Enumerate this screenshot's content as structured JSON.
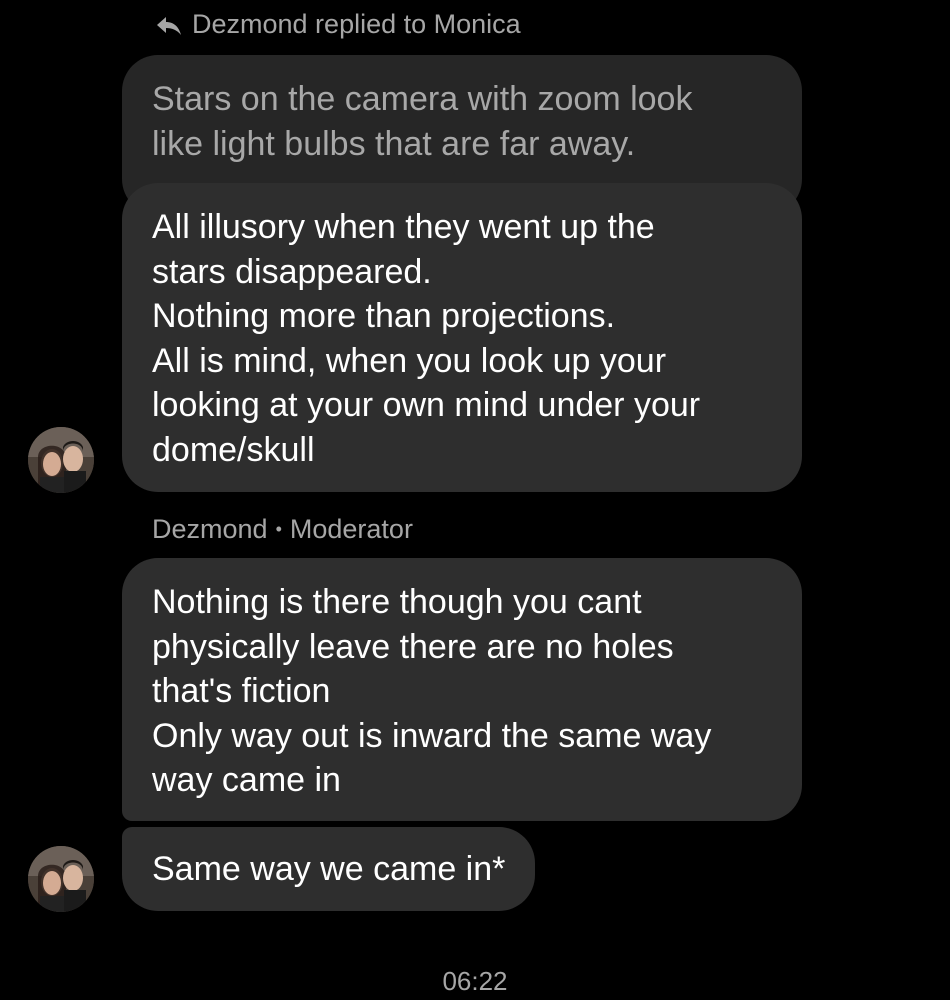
{
  "reply_header": {
    "text": "Dezmond replied to Monica",
    "icon": "reply-arrow-icon"
  },
  "quoted_message": {
    "text": "Stars on the camera with zoom look\nlike light bulbs that are far away."
  },
  "messages": [
    {
      "text": "All illusory when they went up the\nstars disappeared.\nNothing more than projections.\nAll is mind, when you look up your\nlooking at your own mind under your\ndome/skull"
    },
    {
      "sender": "Dezmond",
      "separator": "•",
      "role": "Moderator",
      "text": "Nothing is there though you cant\nphysically leave there are no holes\nthat's fiction\nOnly way out is inward the same way\nway came in"
    },
    {
      "text": "Same way we came in*"
    }
  ],
  "timestamp": "06:22",
  "colors": {
    "background": "#000000",
    "bubble": "#2e2e2e",
    "quoted_bubble": "#262626",
    "secondary_text": "#a6a6a6",
    "primary_text": "#ffffff"
  }
}
